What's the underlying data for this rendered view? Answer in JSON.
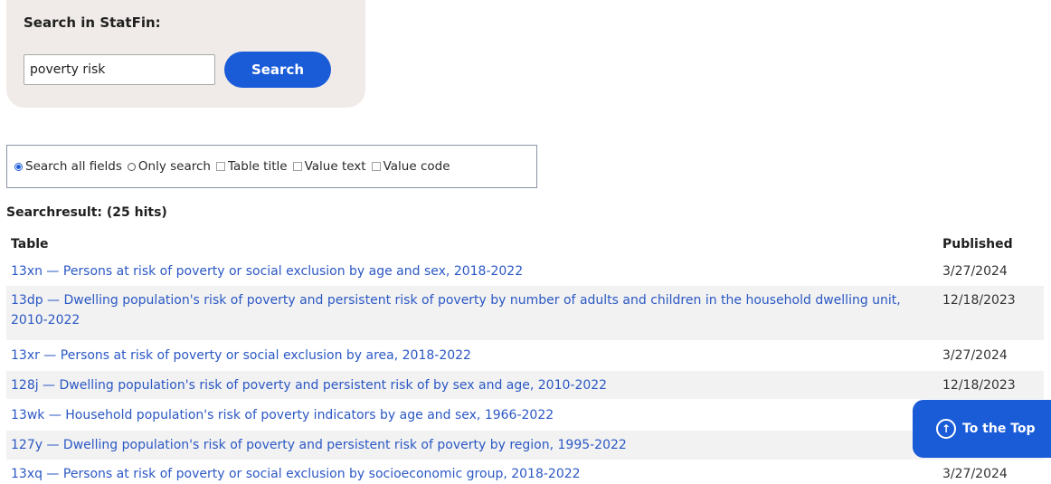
{
  "search": {
    "title": "Search in StatFin:",
    "input_value": "poverty risk",
    "button_label": "Search"
  },
  "options": {
    "search_all_fields": "Search all fields",
    "only_search": "Only search",
    "table_title": "Table title",
    "value_text": "Value text",
    "value_code": "Value code",
    "selected": "search_all_fields"
  },
  "results": {
    "heading": "Searchresult: (25 hits)",
    "col_table": "Table",
    "col_published": "Published",
    "rows": [
      {
        "title": "13xn — Persons at risk of poverty or social exclusion by age and sex, 2018-2022",
        "published": "3/27/2024"
      },
      {
        "title": "13dp — Dwelling population's risk of poverty and persistent risk of poverty by number of adults and children in the household dwelling unit, 2010-2022",
        "published": "12/18/2023"
      },
      {
        "title": "13xr — Persons at risk of poverty or social exclusion by area, 2018-2022",
        "published": "3/27/2024"
      },
      {
        "title": "128j — Dwelling population's risk of poverty and persistent risk of by sex and age, 2010-2022",
        "published": "12/18/2023"
      },
      {
        "title": "13wk — Household population's risk of poverty indicators by age and sex, 1966-2022",
        "published": ""
      },
      {
        "title": "127y — Dwelling population's risk of poverty and persistent risk of poverty by region, 1995-2022",
        "published": ""
      },
      {
        "title": "13xq — Persons at risk of poverty or social exclusion by socioeconomic group, 2018-2022",
        "published": "3/27/2024"
      }
    ]
  },
  "to_top": {
    "label": "To the Top",
    "icon": "arrow-up-circle-icon"
  },
  "colors": {
    "accent": "#1a5bd8",
    "link": "#2b58c4",
    "search_panel_bg": "#f0ebe8"
  }
}
